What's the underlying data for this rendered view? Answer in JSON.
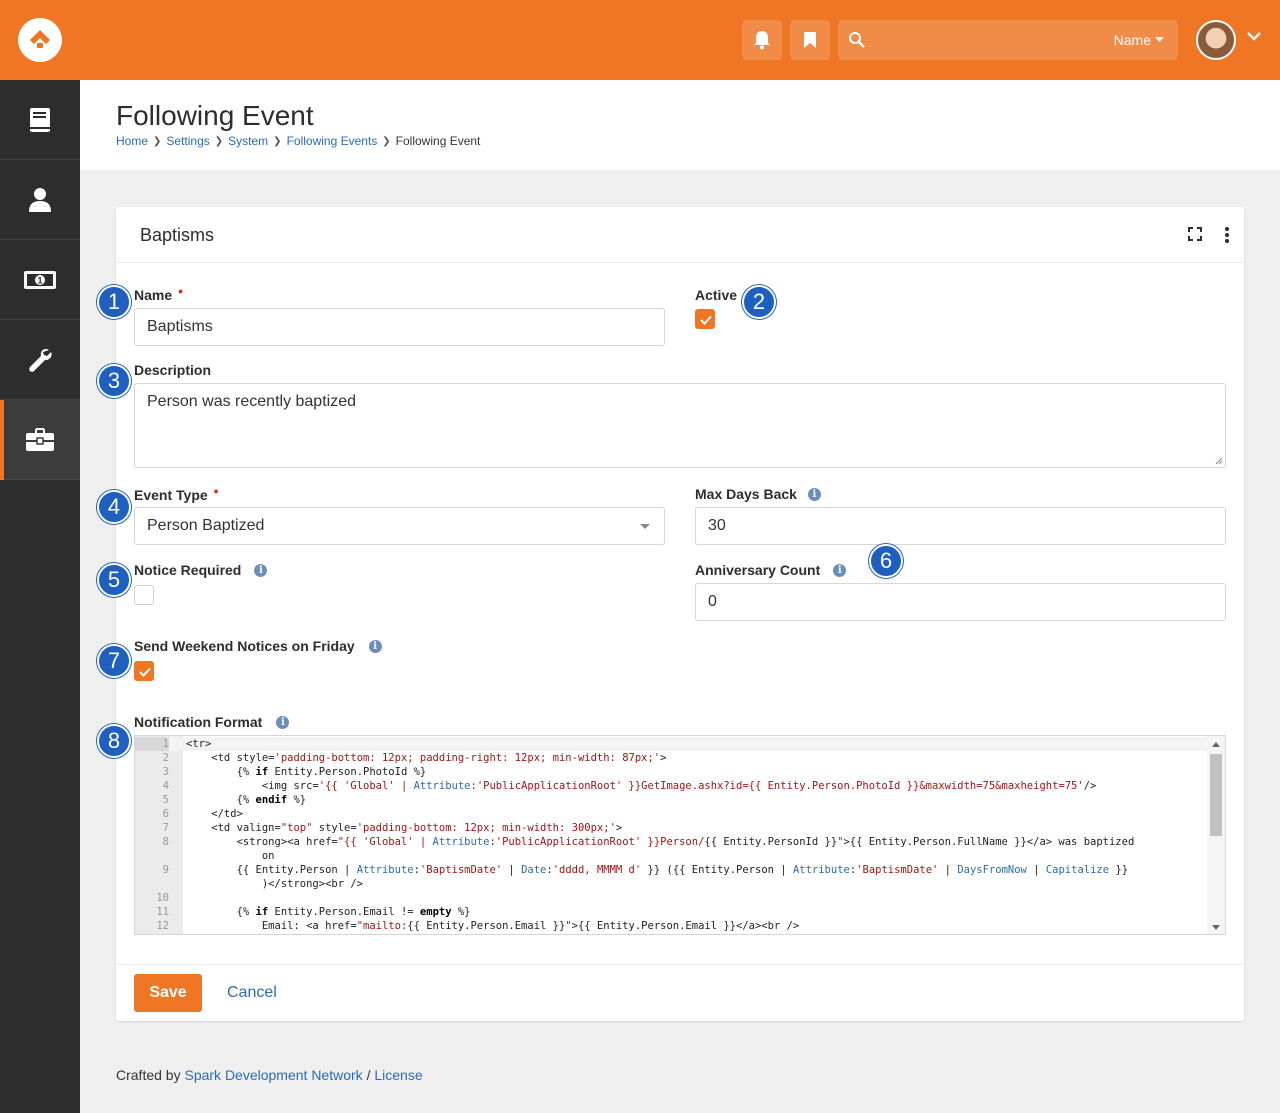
{
  "header": {
    "search_filter_label": "Name",
    "accent_color": "#ee7625"
  },
  "sidebar": {
    "items": [
      {
        "icon": "book-icon"
      },
      {
        "icon": "person-icon"
      },
      {
        "icon": "money-icon"
      },
      {
        "icon": "wrench-icon"
      },
      {
        "icon": "briefcase-icon",
        "active": true
      }
    ]
  },
  "page": {
    "title": "Following Event",
    "breadcrumb": [
      "Home",
      "Settings",
      "System",
      "Following Events",
      "Following Event"
    ]
  },
  "panel": {
    "title": "Baptisms"
  },
  "form": {
    "name_label": "Name",
    "name_value": "Baptisms",
    "active_label": "Active",
    "active_checked": true,
    "description_label": "Description",
    "description_value": "Person was recently baptized",
    "event_type_label": "Event Type",
    "event_type_value": "Person Baptized",
    "max_days_back_label": "Max Days Back",
    "max_days_back_value": "30",
    "notice_required_label": "Notice Required",
    "notice_required_checked": false,
    "anniversary_count_label": "Anniversary Count",
    "anniversary_count_value": "0",
    "send_weekend_label": "Send Weekend Notices on Friday",
    "send_weekend_checked": true,
    "notification_format_label": "Notification Format"
  },
  "badges": [
    "1",
    "2",
    "3",
    "4",
    "5",
    "6",
    "7",
    "8"
  ],
  "code": {
    "line_numbers": [
      "1",
      "2",
      "3",
      "4",
      "5",
      "6",
      "7",
      "8",
      "",
      "9",
      "",
      "10",
      "11",
      "12"
    ]
  },
  "actions": {
    "save_label": "Save",
    "cancel_label": "Cancel"
  },
  "footer": {
    "prefix": "Crafted by",
    "link1": "Spark Development Network",
    "separator": "/",
    "link2": "License"
  }
}
